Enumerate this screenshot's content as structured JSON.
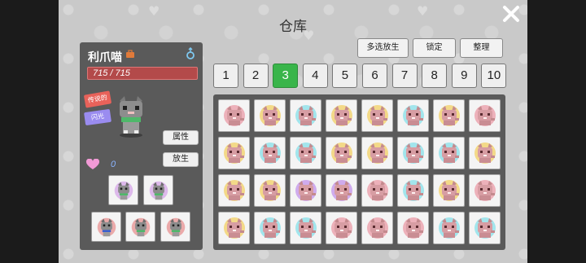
{
  "window": {
    "title": "仓库"
  },
  "pet": {
    "name": "利爪喵",
    "hp_text": "715 / 715",
    "hp": {
      "current": 715,
      "max": 715
    },
    "rarity_badge": "传说的",
    "shiny_badge": "闪光",
    "hearts": "0",
    "actions": {
      "attributes_label": "属性",
      "release_label": "放生"
    },
    "equipped_icons": [
      "grey-cat-pet-icon",
      "grey-cat-pet-icon",
      "red-cat-pet-icon",
      "grey-cat-pet-icon",
      "grey-cat-pet-icon"
    ]
  },
  "toolbar": {
    "multi_release_label": "多选放生",
    "lock_label": "锁定",
    "sort_label": "整理"
  },
  "pages": [
    "1",
    "2",
    "3",
    "4",
    "5",
    "6",
    "7",
    "8",
    "9",
    "10"
  ],
  "active_page": "3",
  "storage": {
    "slots": [
      "red",
      "yellow",
      "cyan",
      "yellow",
      "yellow",
      "cyan",
      "yellow",
      "red",
      "yellow",
      "cyan",
      "cyan",
      "yellow",
      "yellow",
      "cyan",
      "cyan",
      "yellow",
      "yellow",
      "yellow",
      "purple",
      "purple",
      "red",
      "cyan",
      "yellow",
      "red",
      "yellow",
      "cyan",
      "cyan",
      "red",
      "red",
      "red",
      "cyan",
      "cyan"
    ]
  },
  "colors": {
    "active_tab": "#39b54a",
    "aura_red": "#e87a8a",
    "aura_yellow": "#f2c230",
    "aura_cyan": "#5fd8e6",
    "aura_purple": "#b070e8"
  }
}
